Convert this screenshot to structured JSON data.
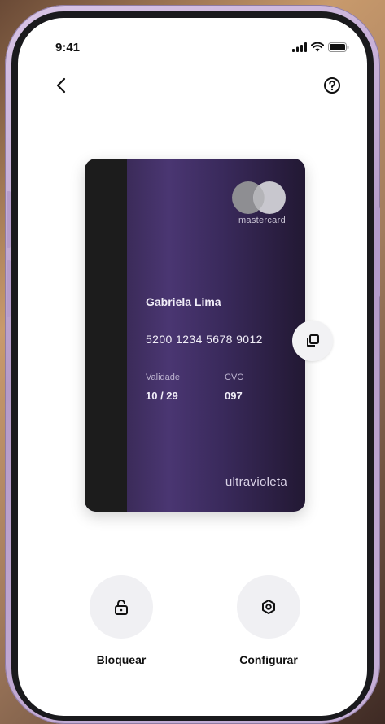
{
  "status_bar": {
    "time": "9:41"
  },
  "header": {
    "back_icon": "chevron-left-icon",
    "help_icon": "help-circle-icon"
  },
  "card": {
    "network": "mastercard",
    "holder_name": "Gabriela Lima",
    "number": "5200 1234 5678 9012",
    "expiry_label": "Validade",
    "expiry_value": "10 / 29",
    "cvc_label": "CVC",
    "cvc_value": "097",
    "brand": "ultravioleta",
    "colors": {
      "gradient_start": "#2c2040",
      "gradient_mid": "#4a3672",
      "gradient_end": "#221833",
      "stripe": "#1c1c1c"
    }
  },
  "copy_button": {
    "icon": "copy-icon"
  },
  "actions": [
    {
      "label": "Bloquear",
      "icon": "lock-icon"
    },
    {
      "label": "Configurar",
      "icon": "settings-icon"
    }
  ]
}
